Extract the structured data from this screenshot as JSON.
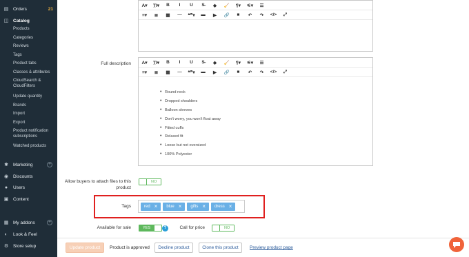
{
  "sidebar": {
    "orders": {
      "label": "Orders",
      "count": "21"
    },
    "catalog": {
      "label": "Catalog"
    },
    "catalog_items": [
      "Products",
      "Categories",
      "Reviews",
      "Tags",
      "Product tabs",
      "Classes & attributes",
      "CloudSearch & CloudFilters",
      "Update quantity",
      "Brands",
      "Import",
      "Export",
      "Product notification subscriptions",
      "Watched products"
    ],
    "marketing": "Marketing",
    "discounts": "Discounts",
    "users": "Users",
    "content": "Content",
    "my_addons": "My addons",
    "look_feel": "Look & Feel",
    "store_setup": "Store setup"
  },
  "editor_toolbar": {
    "row1": [
      "A▾",
      "T̲I▾",
      "B",
      "I",
      "U",
      "S̶",
      "◆",
      "🧹",
      "¶▾",
      "⚟▾",
      "☰"
    ],
    "row2": [
      "≡▾",
      "≣",
      "▦",
      "—",
      "❝❞▾",
      "▬",
      "▶",
      "🔗",
      "■",
      "↶",
      "↷",
      "</>",
      "⤢"
    ]
  },
  "full_description": {
    "label": "Full description",
    "items": [
      "Round neck",
      "Dropped shoulders",
      "Balloon sleeves",
      "Don't worry, you won't float away",
      "Fitted cuffs",
      "Relaxed fit",
      "Loose but not oversized",
      "100% Polyester"
    ]
  },
  "attach_files": {
    "label_line1": "Allow buyers to attach files to this",
    "label_line2": "product",
    "toggle": "NO"
  },
  "tags": {
    "label": "Tags",
    "values": [
      "red",
      "blue",
      "gifts",
      "dress"
    ]
  },
  "available_for_sale": {
    "label": "Available for sale",
    "toggle": "YES",
    "help": "?"
  },
  "call_for_price": {
    "label": "Call for price",
    "toggle": "NO"
  },
  "footer": {
    "update_button": "Update product",
    "status": "Product is approved",
    "decline_button": "Decline product",
    "clone_button": "Clone this product",
    "preview_link": "Preview product page"
  },
  "colors": {
    "sidebar": "#1f2d38",
    "accent": "#5db85c",
    "tag": "#6ab0e6",
    "highlight": "#e0201f",
    "chat": "#f0633a"
  }
}
